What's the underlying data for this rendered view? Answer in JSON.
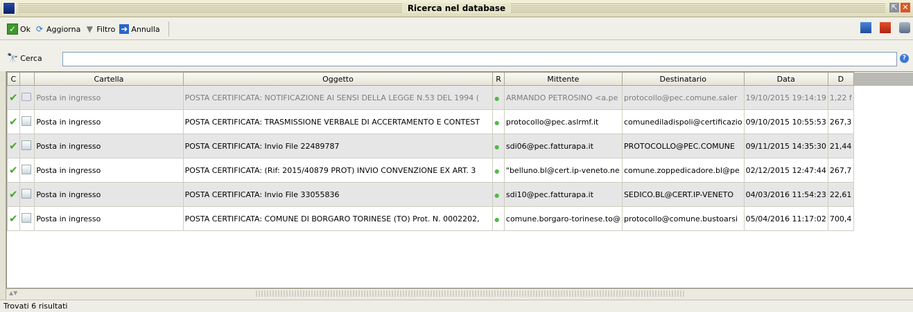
{
  "window": {
    "title": "Ricerca nel database"
  },
  "toolbar": {
    "ok_label": "Ok",
    "aggiorna_label": "Aggiorna",
    "filtro_label": "Filtro",
    "annulla_label": "Annulla",
    "icons": [
      "check-icon",
      "refresh-icon",
      "filter-icon",
      "arrow-icon",
      "save-icon",
      "export-icon",
      "db-icon"
    ]
  },
  "search": {
    "label": "Cerca",
    "value": ""
  },
  "table": {
    "columns": [
      "C",
      "",
      "Cartella",
      "Oggetto",
      "R",
      "Mittente",
      "Destinatario",
      "Data",
      "D"
    ],
    "rows": [
      {
        "cartella": "Posta in ingresso",
        "oggetto": "POSTA CERTIFICATA: NOTIFICAZIONE AI SENSI DELLA LEGGE N.53 DEL 1994 (",
        "mittente": "ARMANDO PETROSINO <a.pe",
        "destinatario": "protocollo@pec.comune.saler",
        "data": "19/10/2015 19:14:19",
        "d": "1,22 f"
      },
      {
        "cartella": "Posta in ingresso",
        "oggetto": "POSTA CERTIFICATA: TRASMISSIONE VERBALE DI ACCERTAMENTO E CONTEST",
        "mittente": "protocollo@pec.aslrmf.it",
        "destinatario": "comunediladispoli@certificazio",
        "data": "09/10/2015 10:55:53",
        "d": "267,3"
      },
      {
        "cartella": "Posta in ingresso",
        "oggetto": "POSTA CERTIFICATA: Invio File 22489787",
        "mittente": "sdi06@pec.fatturapa.it",
        "destinatario": "PROTOCOLLO@PEC.COMUNE",
        "data": "09/11/2015 14:35:30",
        "d": "21,44"
      },
      {
        "cartella": "Posta in ingresso",
        "oggetto": "POSTA CERTIFICATA: (Rif: 2015/40879 PROT) INVIO CONVENZIONE EX ART. 3",
        "mittente": "\"belluno.bl@cert.ip-veneto.ne",
        "destinatario": "comune.zoppedicadore.bl@pe",
        "data": "02/12/2015 12:47:44",
        "d": "267,7"
      },
      {
        "cartella": "Posta in ingresso",
        "oggetto": "POSTA CERTIFICATA: Invio File 33055836",
        "mittente": "sdi10@pec.fatturapa.it",
        "destinatario": "SEDICO.BL@CERT.IP-VENETO",
        "data": "04/03/2016 11:54:23",
        "d": "22,61"
      },
      {
        "cartella": "Posta in ingresso",
        "oggetto": "POSTA CERTIFICATA: COMUNE DI BORGARO TORINESE (TO) Prot. N. 0002202,",
        "mittente": "comune.borgaro-torinese.to@",
        "destinatario": "protocollo@comune.bustoarsi",
        "data": "05/04/2016 11:17:02",
        "d": "700,4"
      }
    ]
  },
  "status": {
    "text": "Trovati 6 risultati"
  }
}
